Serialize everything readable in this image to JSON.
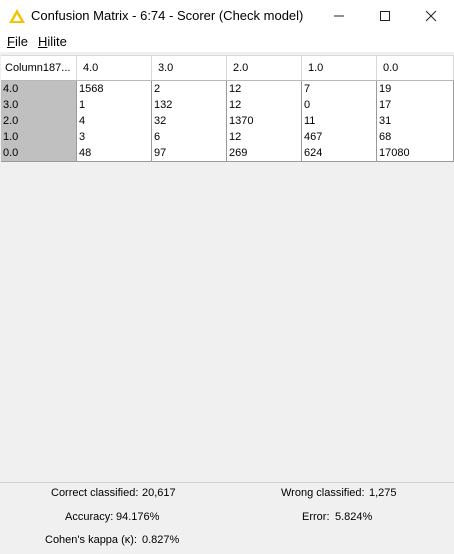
{
  "window": {
    "title": "Confusion Matrix - 6:74 - Scorer (Check model)",
    "icon": "warning-triangle-icon",
    "accent_color": "#f5c400"
  },
  "menu": {
    "file_first": "F",
    "file_rest": "ile",
    "hilite_first": "H",
    "hilite_rest": "ilite"
  },
  "table": {
    "corner_header": "Column187...",
    "columns": [
      "4.0",
      "3.0",
      "2.0",
      "1.0",
      "0.0"
    ],
    "rows": [
      {
        "label": "4.0",
        "cells": [
          "1568",
          "2",
          "12",
          "7",
          "19"
        ]
      },
      {
        "label": "3.0",
        "cells": [
          "1",
          "132",
          "12",
          "0",
          "17"
        ]
      },
      {
        "label": "2.0",
        "cells": [
          "4",
          "32",
          "1370",
          "11",
          "31"
        ]
      },
      {
        "label": "1.0",
        "cells": [
          "3",
          "6",
          "12",
          "467",
          "68"
        ]
      },
      {
        "label": "0.0",
        "cells": [
          "48",
          "97",
          "269",
          "624",
          "17080"
        ]
      }
    ]
  },
  "stats": {
    "correct_label": "Correct classified:",
    "correct_value": "20,617",
    "wrong_label": "Wrong classified:",
    "wrong_value": "1,275",
    "accuracy_label": "Accuracy:",
    "accuracy_value": "94.176%",
    "error_label": "Error:",
    "error_value": "5.824%",
    "kappa_label": "Cohen's kappa (κ):",
    "kappa_value": "0.827%"
  }
}
